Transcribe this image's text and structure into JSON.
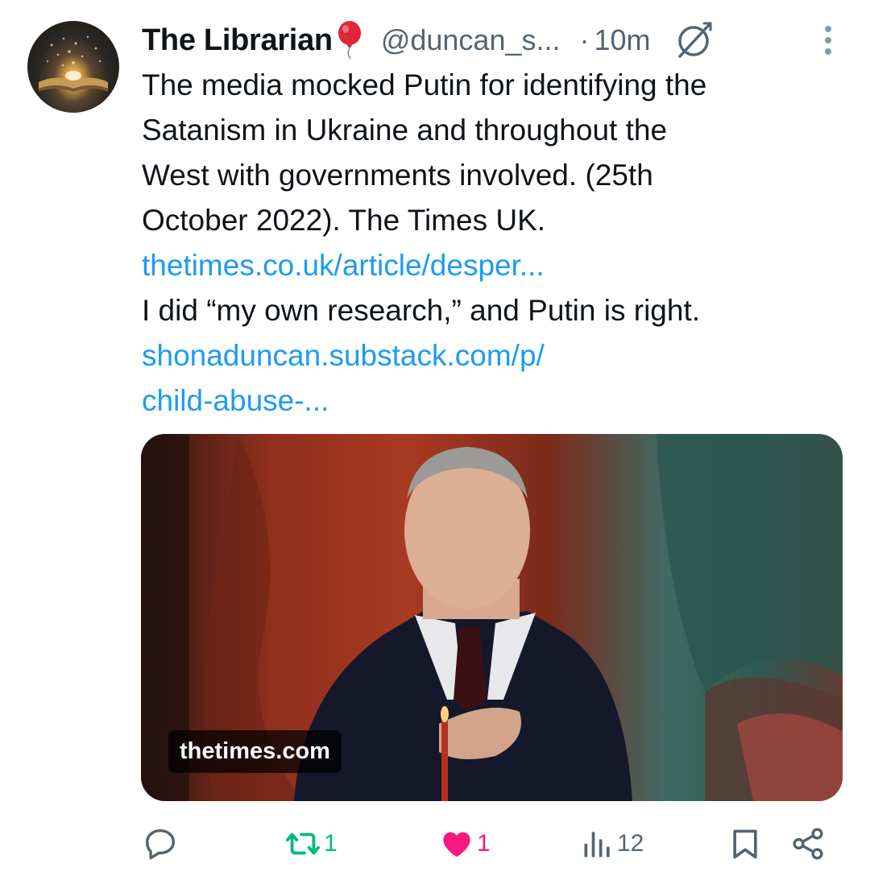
{
  "tweet": {
    "author_name": "The Librarian",
    "author_handle": "@duncan_s...",
    "time_separator": "·",
    "timestamp": "10m",
    "body_lines": [
      "The media mocked Putin for identifying the",
      "Satanism in Ukraine and throughout the",
      "West with governments involved. (25th",
      "October 2022). The Times UK."
    ],
    "link1": "thetimes.co.uk/article/desper...",
    "body_line2": "I did “my own research,” and Putin is right.",
    "link2_lines": [
      "shonaduncan.substack.com/p/",
      "child-abuse-..."
    ],
    "media_domain": "thetimes.com"
  },
  "actions": {
    "reply_count": "",
    "retweet_count": "1",
    "like_count": "1",
    "views_count": "12"
  },
  "icons": {
    "reply": "reply-icon",
    "retweet": "retweet-icon",
    "like": "heart-icon",
    "views": "views-icon",
    "bookmark": "bookmark-icon",
    "share": "share-icon",
    "more": "more-icon",
    "balloon": "balloon-icon",
    "not_synced": "not-synced-icon"
  },
  "colors": {
    "link": "#1d9bf0",
    "secondary_text": "#536471",
    "retweet_active": "#00ba7c",
    "like_active": "#f91880"
  }
}
